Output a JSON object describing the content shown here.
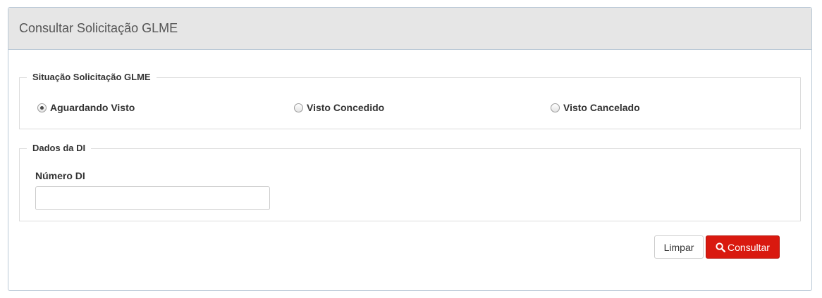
{
  "panel": {
    "title": "Consultar Solicitação GLME"
  },
  "situacao": {
    "legend": "Situação Solicitação GLME",
    "options": [
      {
        "label": "Aguardando Visto",
        "checked": true
      },
      {
        "label": "Visto Concedido",
        "checked": false
      },
      {
        "label": "Visto Cancelado",
        "checked": false
      }
    ]
  },
  "dados": {
    "legend": "Dados da DI",
    "numero_label": "Número DI",
    "numero_value": "",
    "numero_placeholder": ""
  },
  "actions": {
    "limpar_label": "Limpar",
    "consultar_label": "Consultar",
    "consultar_icon": "search-icon"
  },
  "colors": {
    "primary_button": "#d9190f",
    "heading_background": "#e6e6e6"
  }
}
